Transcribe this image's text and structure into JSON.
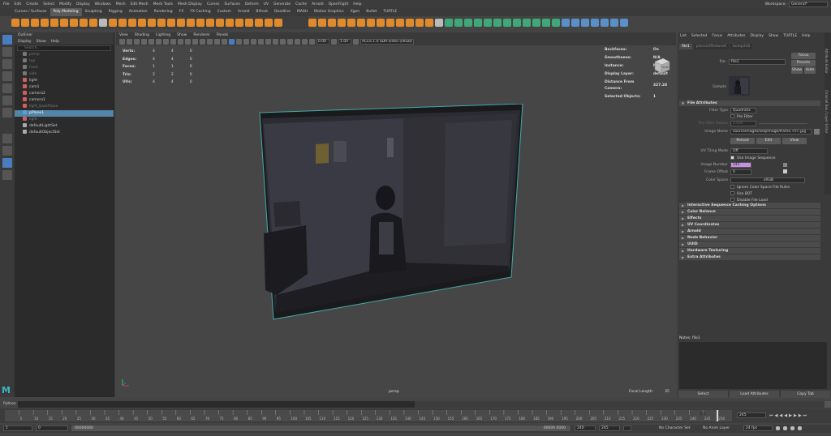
{
  "menubar": {
    "items": [
      "File",
      "Edit",
      "Create",
      "Select",
      "Modify",
      "Display",
      "Windows",
      "Mesh",
      "Edit Mesh",
      "Mesh Tools",
      "Mesh Display",
      "Curves",
      "Surfaces",
      "Deform",
      "UV",
      "Generate",
      "Cache",
      "Arnold",
      "OpenFlight",
      "Help"
    ],
    "workspace_label": "Workspace:",
    "workspace_value": "General*"
  },
  "shelf": {
    "tabs": [
      "Curves / Surfaces",
      "Poly Modeling",
      "Sculpting",
      "Rigging",
      "Animation",
      "Rendering",
      "FX",
      "FX Caching",
      "Custom",
      "Arnold",
      "Bifrost",
      "Deadline",
      "MASH",
      "Motion Graphics",
      "Xgen",
      "Bullet",
      "TURTLE"
    ],
    "active_tab": "Poly Modeling"
  },
  "outliner": {
    "title": "Outliner",
    "menus": [
      "Display",
      "Show",
      "Help"
    ],
    "search_placeholder": "Search...",
    "items": [
      {
        "label": "persp",
        "dim": true,
        "color": "#777"
      },
      {
        "label": "top",
        "dim": true,
        "color": "#777"
      },
      {
        "label": "front",
        "dim": true,
        "color": "#777"
      },
      {
        "label": "side",
        "dim": true,
        "color": "#777"
      },
      {
        "label": "light",
        "dim": false,
        "color": "#d06060"
      },
      {
        "label": "cam1",
        "dim": false,
        "color": "#d06060"
      },
      {
        "label": "camera2",
        "dim": false,
        "color": "#d06060"
      },
      {
        "label": "camera1",
        "dim": false,
        "color": "#d06060"
      },
      {
        "label": "light_backPlane",
        "dim": true,
        "color": "#d06060"
      },
      {
        "label": "pPlane1",
        "dim": false,
        "sel": true,
        "color": "#5aa0e0"
      },
      {
        "label": "light",
        "dim": true,
        "color": "#d06060"
      },
      {
        "label": "defaultLightSet",
        "dim": false,
        "color": "#aaa"
      },
      {
        "label": "defaultObjectSet",
        "dim": false,
        "color": "#aaa"
      }
    ]
  },
  "viewport": {
    "menus": [
      "View",
      "Shading",
      "Lighting",
      "Show",
      "Renderer",
      "Panels"
    ],
    "field_a": "0.00",
    "field_b": "1.00",
    "colorspace": "ACES 1.0 SDR-video (sRGB)",
    "hud_left": [
      {
        "label": "Verts:",
        "a": "4",
        "b": "4",
        "c": "0"
      },
      {
        "label": "Edges:",
        "a": "4",
        "b": "4",
        "c": "0"
      },
      {
        "label": "Faces:",
        "a": "1",
        "b": "1",
        "c": "0"
      },
      {
        "label": "Tris:",
        "a": "2",
        "b": "2",
        "c": "0"
      },
      {
        "label": "UVs:",
        "a": "4",
        "b": "4",
        "c": "0"
      }
    ],
    "hud_right": [
      {
        "label": "Backfaces:",
        "value": "On"
      },
      {
        "label": "Smoothness:",
        "value": "N/A"
      },
      {
        "label": "Instance:",
        "value": "No"
      },
      {
        "label": "Display Layer:",
        "value": "default"
      },
      {
        "label": "Distance From Camera:",
        "value": "327.28"
      },
      {
        "label": "Selected Objects:",
        "value": "1"
      }
    ],
    "viewcube_label": "FRONT",
    "camera_name": "persp",
    "focal_label": "Focal Length:",
    "focal_value": "35"
  },
  "attr": {
    "tabs": [
      "List",
      "Selected",
      "Focus",
      "Attributes",
      "Display",
      "Show",
      "TURTLE",
      "Help"
    ],
    "node_tabs": [
      "file1",
      "place2dTexture4",
      "bump2d1"
    ],
    "file_label": "file:",
    "file_value": "file1",
    "focus_btn": "Focus",
    "presets_btn": "Presets",
    "show_btn": "Show",
    "hide_btn": "Hide",
    "sample_label": "Sample",
    "file_attrs_section": "File Attributes",
    "filter_type_label": "Filter Type",
    "filter_type_value": "Quadratic",
    "prefilter_label": "Pre Filter",
    "prefilter_radius_label": "Pre Filter Radius",
    "prefilter_radius_value": "2.000",
    "image_name_label": "Image Name",
    "image_name_value": "sourceimages/seq/image/frame.<f>.jpg",
    "reload_btn": "Reload",
    "edit_btn": "Edit",
    "view_btn": "View",
    "uv_tiling_label": "UV Tiling Mode",
    "uv_tiling_value": "Off",
    "use_seq_label": "Use Image Sequence",
    "image_number_label": "Image Number",
    "image_number_value": "245",
    "frame_offset_label": "Frame Offset",
    "frame_offset_value": "0",
    "color_space_label": "Color Space",
    "color_space_value": "sRGB",
    "ignore_cs_label": "Ignore Color Space File Rules",
    "use_bot_label": "Use BOT",
    "disable_load_label": "Disable File Load",
    "sections": [
      "Interactive Sequence Caching Options",
      "Color Balance",
      "Effects",
      "UV Coordinates",
      "Arnold",
      "Node Behavior",
      "UUID",
      "Hardware Texturing",
      "Extra Attributes"
    ],
    "notes_label": "Notes: file1",
    "bottom_buttons": [
      "Select",
      "Load Attributes",
      "Copy Tab"
    ],
    "side_tabs": [
      "Attribute Editor",
      "Channel Box / Layer Editor"
    ]
  },
  "cmdline": {
    "lang": "Python"
  },
  "timeline": {
    "current_frame": "245",
    "ticks": [
      "5",
      "10",
      "15",
      "20",
      "25",
      "30",
      "35",
      "40",
      "45",
      "50",
      "55",
      "60",
      "65",
      "70",
      "75",
      "80",
      "85",
      "90",
      "95",
      "100",
      "105",
      "110",
      "115",
      "120",
      "125",
      "130",
      "135",
      "140",
      "145",
      "150",
      "155",
      "160",
      "165",
      "170",
      "175",
      "180",
      "185",
      "190",
      "195",
      "200",
      "205",
      "210",
      "215",
      "220",
      "225",
      "230",
      "235",
      "240",
      "245",
      "250"
    ],
    "playhead_fraction": 0.98
  },
  "range": {
    "start": "1",
    "start2": "0",
    "inner_start": "00000000",
    "inner_end": "00000 0000",
    "end1": "240",
    "end2": "245",
    "no_char_set": "No Character Set",
    "no_anim_layer": "No Anim Layer",
    "fps": "24 fps"
  },
  "colors": {
    "accent": "#5285a6",
    "maya_logo": "#3ab6c4",
    "image_number_field": "#c890e0"
  }
}
